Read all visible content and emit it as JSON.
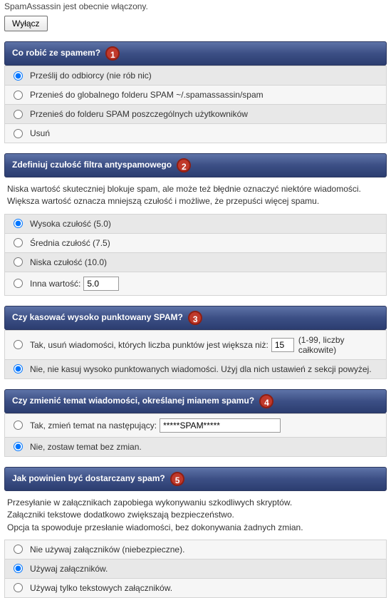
{
  "status": {
    "text": "SpamAssassin jest obecnie włączony.",
    "toggle_button": "Wyłącz"
  },
  "sections": {
    "s1": {
      "title": "Co robić ze spamem?",
      "badge": "1",
      "options": [
        "Prześlij do odbiorcy (nie rób nic)",
        "Przenieś do globalnego folderu SPAM ~/.spamassassin/spam",
        "Przenieś do folderu SPAM poszczególnych użytkowników",
        "Usuń"
      ]
    },
    "s2": {
      "title": "Zdefiniuj czułość filtra antyspamowego",
      "badge": "2",
      "desc1": "Niska wartość skuteczniej blokuje spam, ale może też błędnie oznaczyć niektóre wiadomości.",
      "desc2": "Większa wartość oznacza mniejszą czułość i możliwe, że przepuści więcej spamu.",
      "options": [
        "Wysoka czułość (5.0)",
        "Średnia czułość (7.5)",
        "Niska czułość (10.0)",
        "Inna wartość:"
      ],
      "custom_value": "5.0"
    },
    "s3": {
      "title": "Czy kasować wysoko punktowany SPAM?",
      "badge": "3",
      "opt_yes": "Tak, usuń wiadomości, których liczba punktów jest większa niż:",
      "opt_no": "Nie, nie kasuj wysoko punktowanych wiadomości. Użyj dla nich ustawień z sekcji powyżej.",
      "threshold": "15",
      "suffix": "(1-99, liczby całkowite)"
    },
    "s4": {
      "title": "Czy zmienić temat wiadomości, określanej mianem spamu?",
      "badge": "4",
      "opt_yes": "Tak, zmień temat na następujący:",
      "opt_no": "Nie, zostaw temat bez zmian.",
      "subject_value": "*****SPAM*****"
    },
    "s5": {
      "title": "Jak powinien być dostarczany spam?",
      "badge": "5",
      "desc1": "Przesyłanie w załącznikach zapobiega wykonywaniu szkodliwych skryptów.",
      "desc2": "Załączniki tekstowe dodatkowo zwiększają bezpieczeństwo.",
      "desc3": "Opcja ta spowoduje przesłanie wiadomości, bez dokonywania żadnych zmian.",
      "options": [
        "Nie używaj załączników (niebezpieczne).",
        "Używaj załączników.",
        "Używaj tylko tekstowych załączników."
      ]
    }
  }
}
